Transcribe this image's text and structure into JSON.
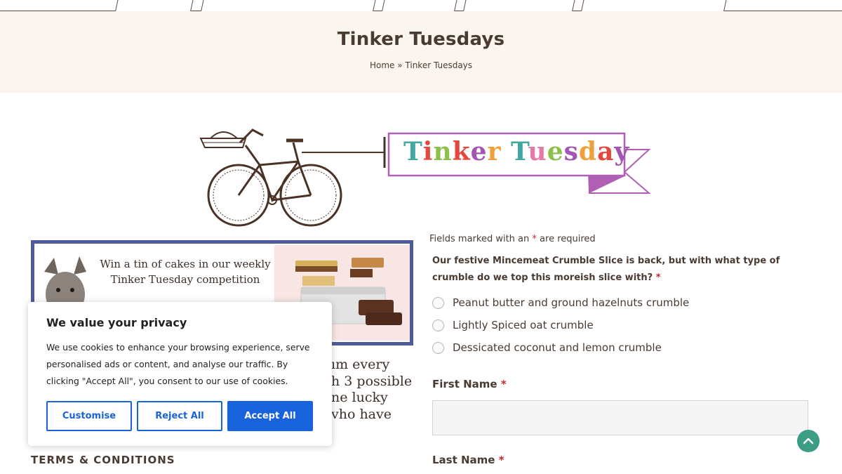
{
  "page": {
    "title": "Tinker Tuesdays",
    "breadcrumb": {
      "home": "Home",
      "separator": "»",
      "current": "Tinker Tuesdays"
    }
  },
  "banner": {
    "ribbon_title": "Tinker Tuesday",
    "ribbon_letters": [
      {
        "ch": "T",
        "color": "#3fa9a0"
      },
      {
        "ch": "i",
        "color": "#e5473f"
      },
      {
        "ch": "n",
        "color": "#8cc04a"
      },
      {
        "ch": "k",
        "color": "#e5473f"
      },
      {
        "ch": "e",
        "color": "#a355b4"
      },
      {
        "ch": "r",
        "color": "#f0a03a"
      },
      {
        "ch": " ",
        "color": "#000000"
      },
      {
        "ch": "T",
        "color": "#3fa9a0"
      },
      {
        "ch": "u",
        "color": "#e57aa7"
      },
      {
        "ch": "e",
        "color": "#8cc04a"
      },
      {
        "ch": "s",
        "color": "#a355b4"
      },
      {
        "ch": "d",
        "color": "#f0a03a"
      },
      {
        "ch": "a",
        "color": "#e5473f"
      },
      {
        "ch": "y",
        "color": "#a355b4"
      }
    ]
  },
  "promo": {
    "headline": "Win a tin of cakes in our weekly Tinker Tuesday competition"
  },
  "article_fragment": [
    "ım every",
    "h 3 possible",
    "ne lucky",
    "vho have"
  ],
  "terms_heading": "TERMS & CONDITIONS",
  "form": {
    "required_note": "Fields marked with an",
    "required_note_suffix": "are required",
    "required_mark": "*",
    "question": "Our festive Mincemeat Crumble Slice is back, but with what type of crumble do we top this moreish slice with?",
    "options": [
      "Peanut butter and ground hazelnuts crumble",
      "Lightly Spiced oat crumble",
      "Dessicated coconut and lemon crumble"
    ],
    "first_name_label": "First Name",
    "first_name_value": "",
    "last_name_label": "Last Name"
  },
  "cookie": {
    "title": "We value your privacy",
    "body": "We use cookies to enhance your browsing experience, serve personalised ads or content, and analyse our traffic. By clicking \"Accept All\", you consent to our use of cookies.",
    "customise": "Customise",
    "reject": "Reject All",
    "accept": "Accept All"
  },
  "colors": {
    "accent_blue": "#1863dc",
    "header_bg": "#faf5ee",
    "promo_border": "#4f5a99",
    "scroll_top": "#3a9d86",
    "required": "#c8272c"
  },
  "icons": {
    "scroll_top": "chevron-up-icon"
  }
}
